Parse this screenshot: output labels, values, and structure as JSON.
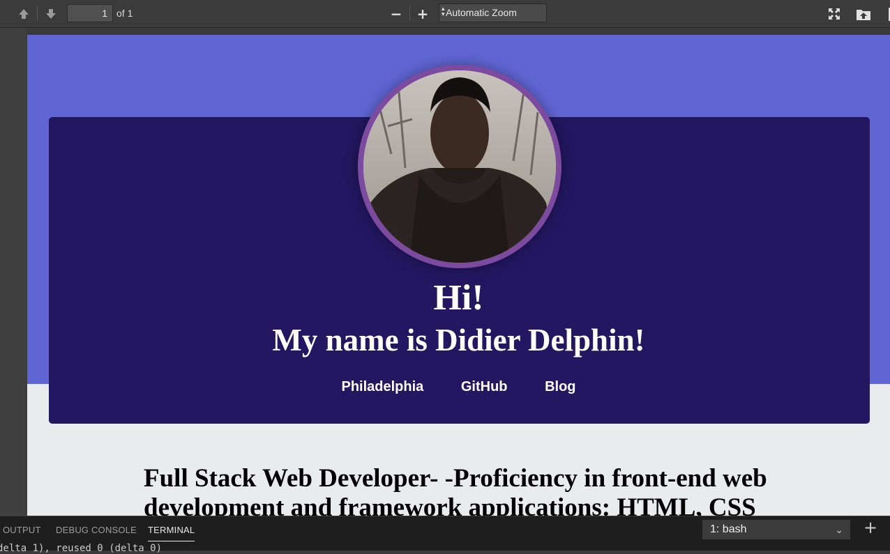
{
  "toolbar": {
    "page_number": "1",
    "page_count_label": "of 1",
    "zoom_minus": "−",
    "zoom_plus": "+",
    "zoom_value": "Automatic Zoom"
  },
  "page": {
    "greeting": "Hi!",
    "intro": "My name is Didier Delphin!",
    "links": [
      "Philadelphia",
      "GitHub",
      "Blog"
    ],
    "headline": "Full Stack Web Developer- -Proficiency in front-end web development and framework applications: HTML, CSS"
  },
  "panel": {
    "tabs": [
      "OUTPUT",
      "DEBUG CONSOLE",
      "TERMINAL"
    ],
    "active_tab": "TERMINAL",
    "terminal_select": "1: bash",
    "terminal_line": "delta 1), reused 0 (delta 0)"
  },
  "colors": {
    "hero_bg": "#5f65d3",
    "card_bg": "#221760",
    "avatar_ring": "#7c4a9e"
  }
}
